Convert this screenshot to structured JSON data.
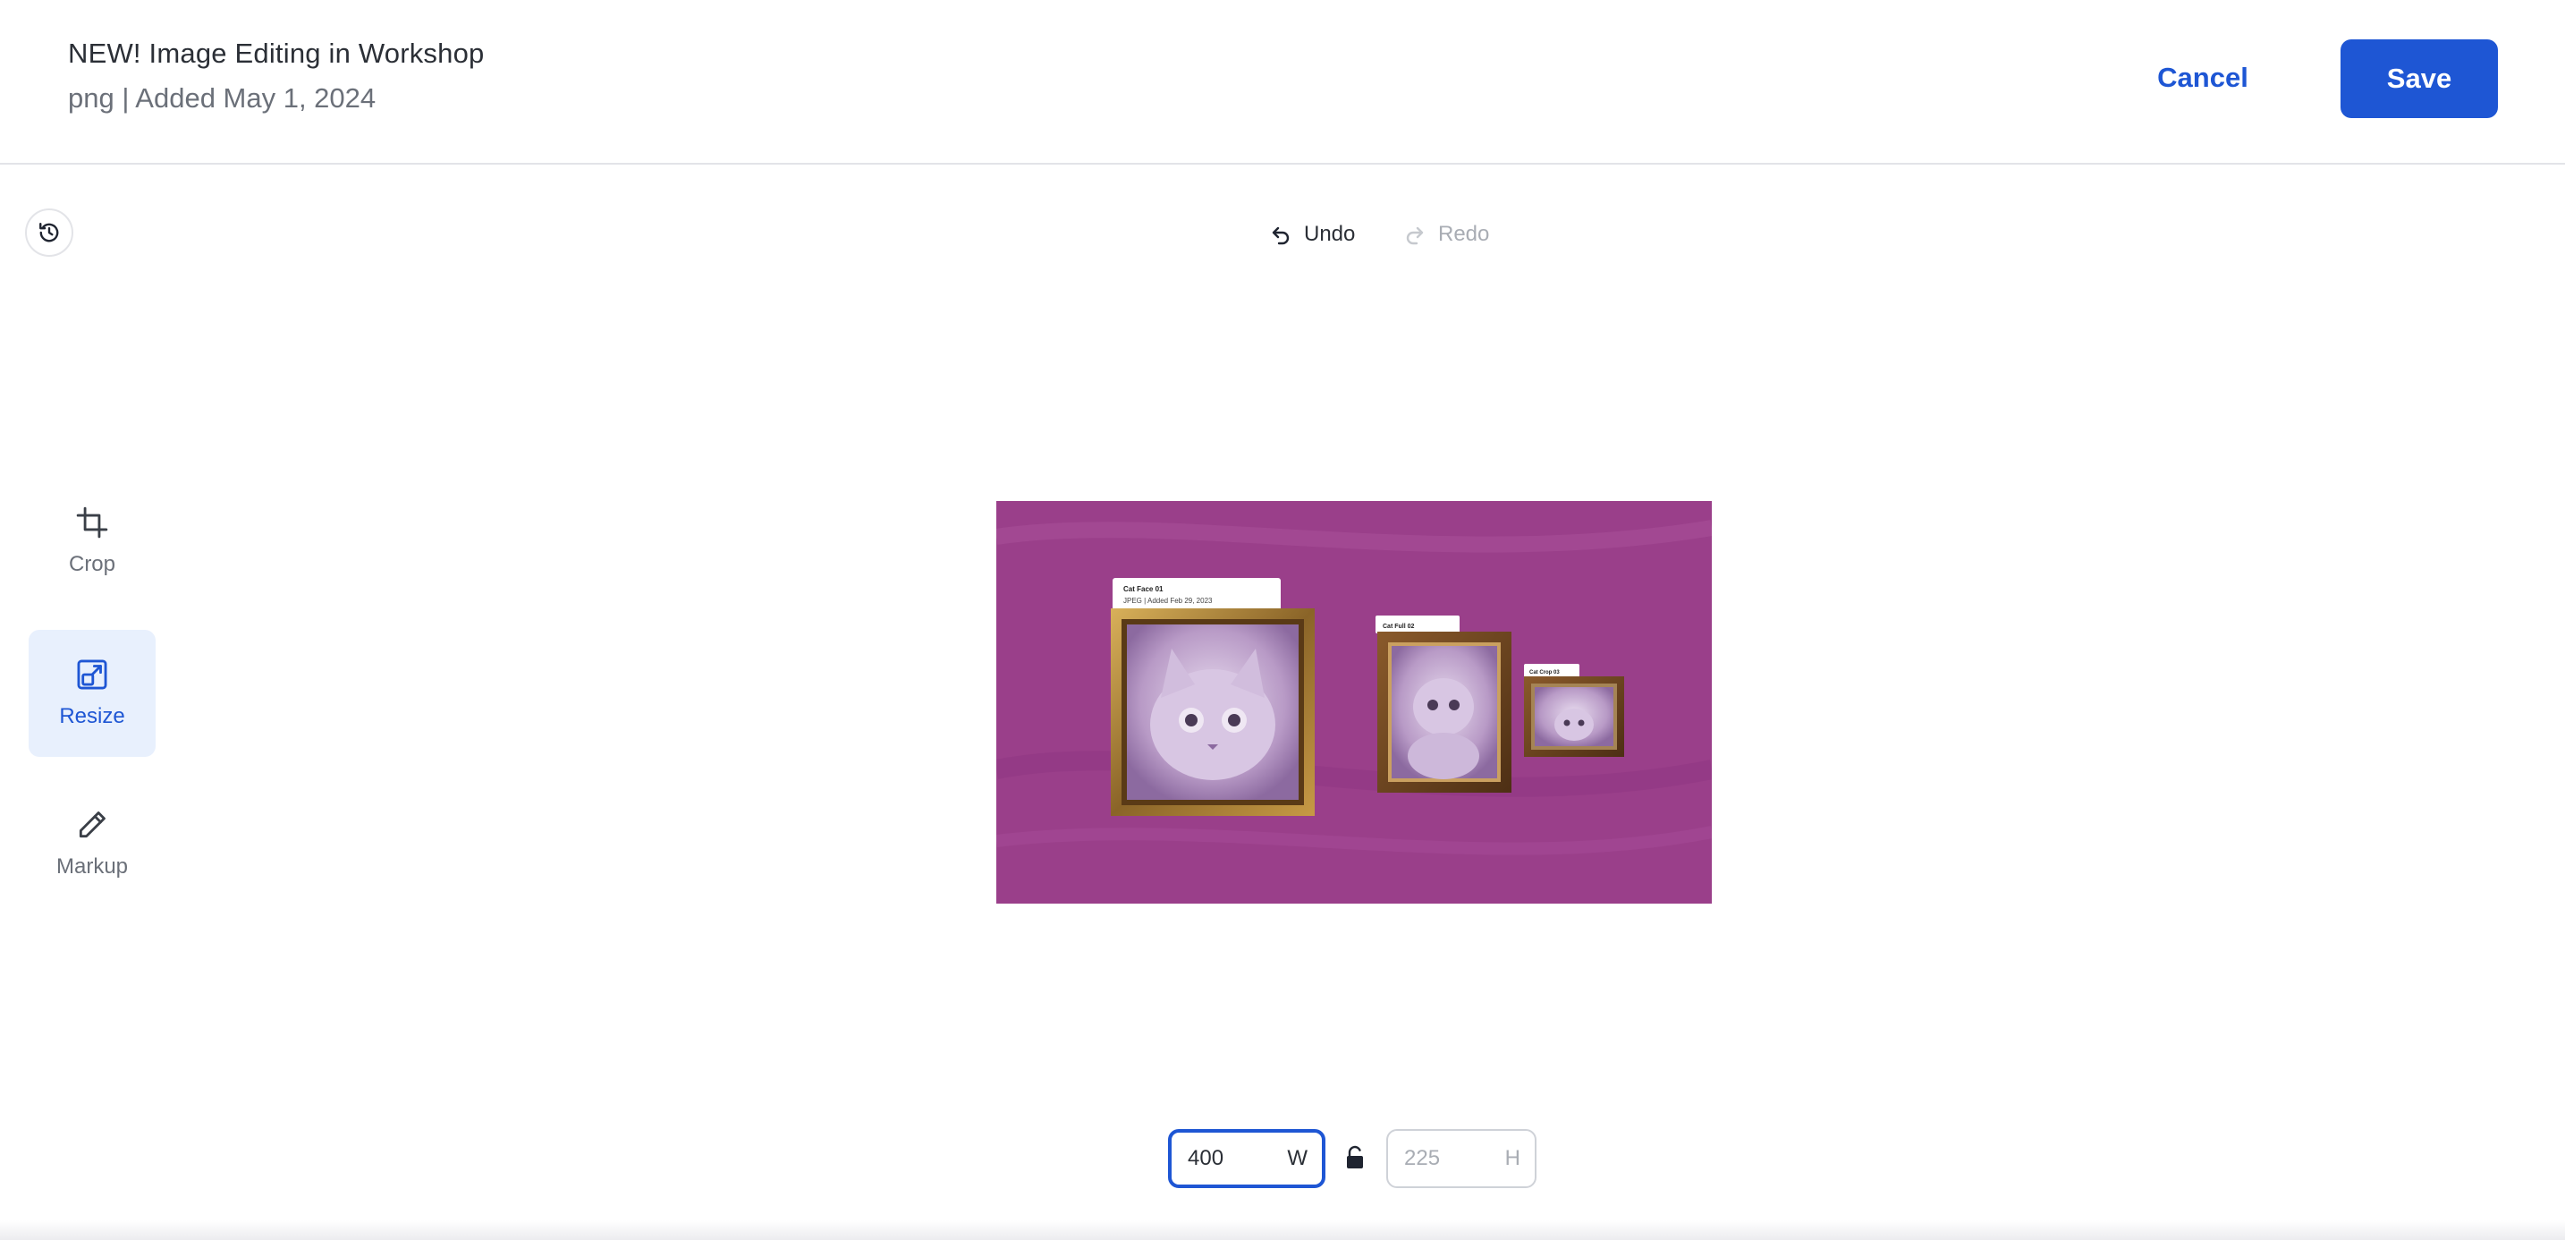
{
  "header": {
    "title": "NEW! Image Editing in Workshop",
    "subtitle": "png | Added May 1, 2024",
    "cancel_label": "Cancel",
    "save_label": "Save"
  },
  "history": {
    "undo_label": "Undo",
    "redo_label": "Redo"
  },
  "tools": {
    "crop_label": "Crop",
    "resize_label": "Resize",
    "markup_label": "Markup",
    "active": "Resize"
  },
  "preview": {
    "card1_title": "Cat Face 01",
    "card1_meta": "JPEG | Added Feb 29, 2023",
    "card2_title": "Cat Full 02",
    "card3_title": "Cat Crop 03"
  },
  "resize": {
    "width_value": "400",
    "width_unit": "W",
    "height_value": "225",
    "height_unit": "H",
    "aspect_locked": false
  },
  "colors": {
    "accent": "#1e56d4",
    "active_tool_bg": "#e8f0fd",
    "canvas_bg": "#9a3f8a"
  }
}
